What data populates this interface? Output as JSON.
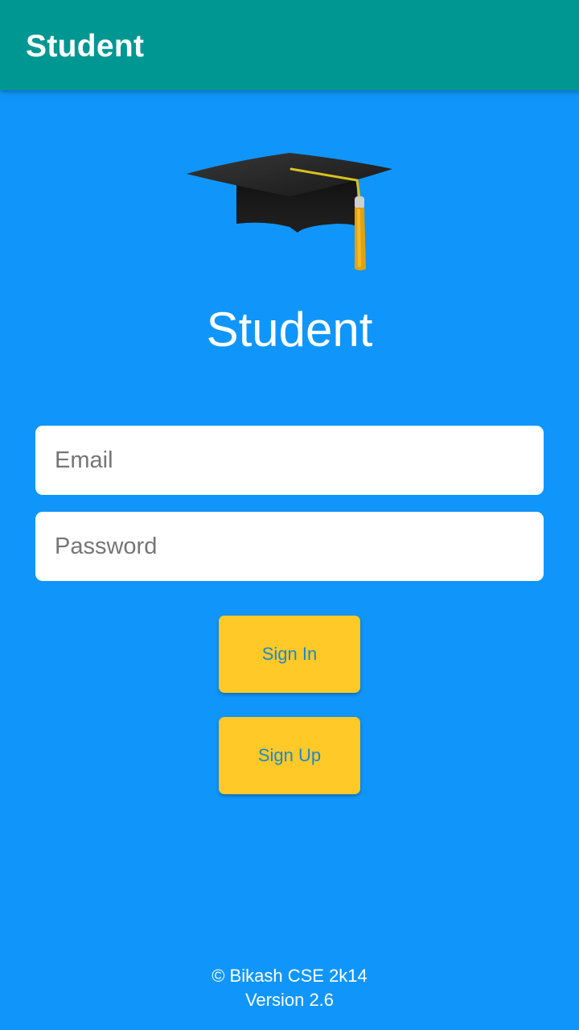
{
  "app_bar": {
    "title": "Student"
  },
  "logo": {
    "icon": "graduation-cap-icon"
  },
  "heading": "Student",
  "form": {
    "email_placeholder": "Email",
    "password_placeholder": "Password"
  },
  "buttons": {
    "sign_in": "Sign In",
    "sign_up": "Sign Up"
  },
  "footer": {
    "copyright": "© Bikash CSE 2k14",
    "version": "Version 2.6"
  },
  "colors": {
    "app_bar": "#009793",
    "background": "#1096fa",
    "button": "#ffc928",
    "button_text": "#1e88c8"
  }
}
